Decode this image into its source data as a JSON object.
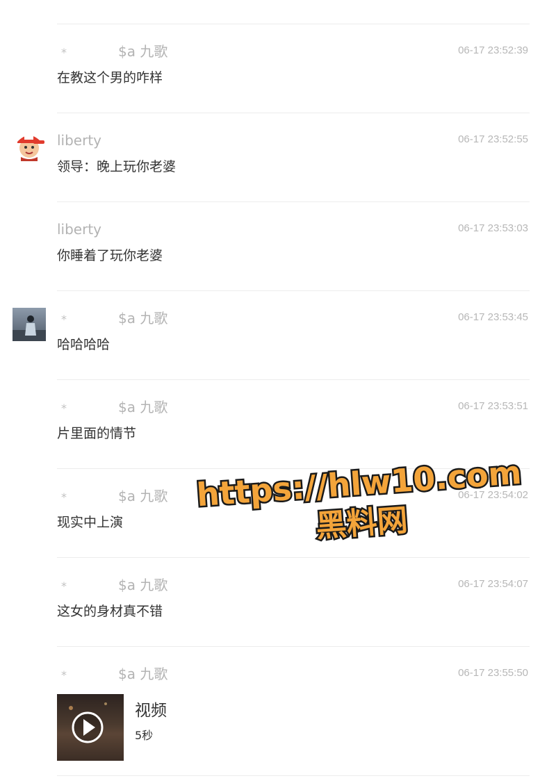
{
  "messages": [
    {
      "name": "$a 九歌",
      "star": "*",
      "time": "06-17 23:52:39",
      "text": "在教这个男的咋样"
    },
    {
      "name": "liberty",
      "star": "",
      "time": "06-17 23:52:55",
      "text": "领导：晚上玩你老婆"
    },
    {
      "name": "liberty",
      "star": "",
      "time": "06-17 23:53:03",
      "text": "你睡着了玩你老婆"
    },
    {
      "name": "$a 九歌",
      "star": "*",
      "time": "06-17 23:53:45",
      "text": "哈哈哈哈"
    },
    {
      "name": "$a 九歌",
      "star": "*",
      "time": "06-17 23:53:51",
      "text": "片里面的情节"
    },
    {
      "name": "$a 九歌",
      "star": "*",
      "time": "06-17 23:54:02",
      "text": "现实中上演"
    },
    {
      "name": "$a 九歌",
      "star": "*",
      "time": "06-17 23:54:07",
      "text": "这女的身材真不错"
    },
    {
      "name": "$a 九歌",
      "star": "*",
      "time": "06-17 23:55:50",
      "video": {
        "label": "视频",
        "duration": "5秒"
      }
    }
  ],
  "watermark": {
    "line1": "https://hlw10.com",
    "line2": "黑料网"
  }
}
